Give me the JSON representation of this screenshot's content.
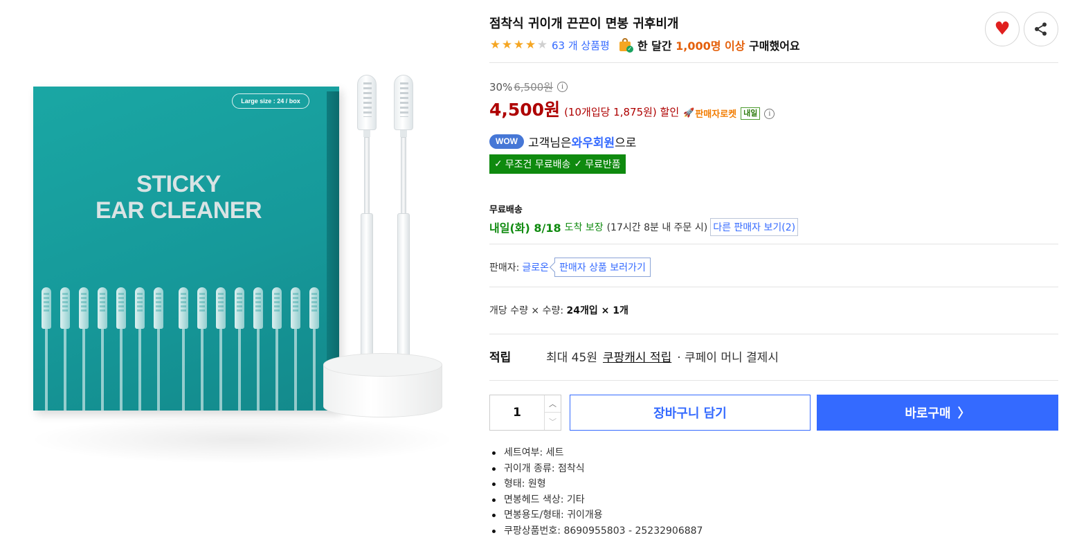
{
  "product_image": {
    "box_badge": "Large size : 24 / box",
    "box_title_line1": "STICKY",
    "box_title_line2": "EAR CLEANER"
  },
  "product": {
    "title": "점착식 귀이개 끈끈이 면봉 귀후비개",
    "rating_stars": 4,
    "review_link": "63 개 상품평",
    "sales_prefix": "한 달간 ",
    "sales_highlight": "1,000명 이상",
    "sales_suffix": " 구매했어요"
  },
  "actions": {
    "heart_icon": "heart-icon",
    "share_icon": "share-icon"
  },
  "price": {
    "discount_rate": "30%",
    "original_price": "6,500원",
    "sale_price": "4,500원",
    "unit_price": "(10개입당 1,875원) 할인",
    "rocket_label": "판매자로켓",
    "tomorrow_badge": "내일"
  },
  "wow": {
    "badge": "WOW",
    "text_before": "고객님은 ",
    "member": "와우회원",
    "text_after": "으로",
    "free_shipping": "무조건 무료배송",
    "free_return": "무료반품"
  },
  "shipping": {
    "label": "무료배송",
    "date": "내일(화) 8/18",
    "guarantee": "도착 보장",
    "note": "(17시간 8분 내 주문 시)",
    "other_sellers": "다른 판매자 보기(2)"
  },
  "seller": {
    "label": "판매자:",
    "name": "글로온",
    "link": "판매자 상품 보러가기"
  },
  "quantity_info": {
    "prefix": "개당 수량 × 수량:",
    "value": "24개입 × 1개"
  },
  "points": {
    "label": "적립",
    "text": "최대 45원",
    "cash_link": "쿠팡캐시 적립",
    "suffix": "· 쿠페이 머니 결제시"
  },
  "purchase": {
    "quantity": "1",
    "cart_label": "장바구니 담기",
    "buy_label": "바로구매"
  },
  "attributes": [
    "세트여부: 세트",
    "귀이개 종류: 점착식",
    "형태: 원형",
    "면봉헤드 색상: 기타",
    "면봉용도/형태: 귀이개용",
    "쿠팡상품번호: 8690955803 - 25232906887"
  ],
  "colors": {
    "accent_blue": "#346aff",
    "price_red": "#ae0000",
    "ship_green": "#0f8a0f",
    "rocket_orange": "#f27c00",
    "box_teal": "#1aa7a4"
  }
}
